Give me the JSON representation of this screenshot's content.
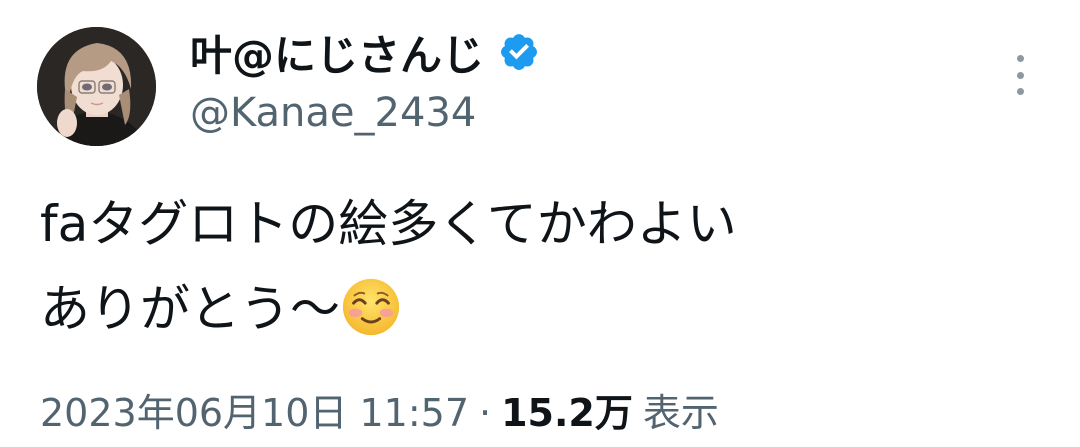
{
  "author": {
    "display_name": "叶@にじさんじ",
    "handle": "@Kanae_2434",
    "verified": true,
    "verified_color": "#1d9bf0"
  },
  "tweet": {
    "line1": "faタグロトの絵多くてかわよい",
    "line2": "ありがとう〜",
    "emoji": "smiling-face-with-blush-emoji"
  },
  "meta": {
    "timestamp": "2023年06月10日 11:57",
    "separator": "·",
    "views_count": "15.2万",
    "views_label": "表示"
  },
  "icons": {
    "more": "more-vertical-icon",
    "verified": "verified-badge-icon"
  }
}
